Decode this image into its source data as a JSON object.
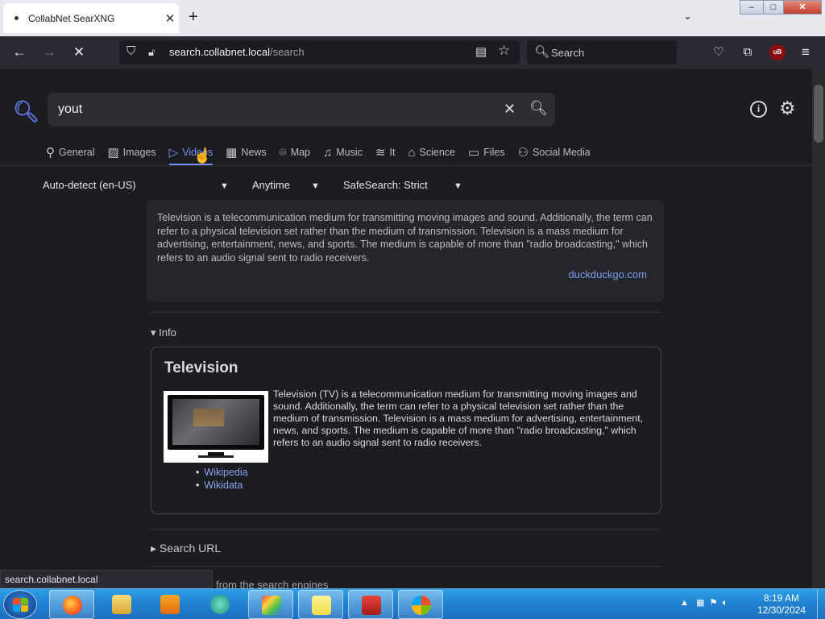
{
  "browser": {
    "tab_title": "CollabNet SearXNG",
    "tab_close": "✕",
    "new_tab": "+",
    "url_host": "search.collabnet.local",
    "url_path": "/search",
    "search_placeholder": "Search"
  },
  "search": {
    "query": "yout",
    "categories": [
      "General",
      "Images",
      "Videos",
      "News",
      "Map",
      "Music",
      "It",
      "Science",
      "Files",
      "Social Media"
    ],
    "active_category": "Videos",
    "filters": {
      "language": "Auto-detect (en-US)",
      "time": "Anytime",
      "safesearch": "SafeSearch: Strict"
    }
  },
  "answer": {
    "text": "Television is a telecommunication medium for transmitting moving images and sound. Additionally, the term can refer to a physical television set rather than the medium of transmission. Television is a mass medium for advertising, entertainment, news, and sports. The medium is capable of more than \"radio broadcasting,\" which refers to an audio signal sent to radio receivers.",
    "source": "duckduckgo.com"
  },
  "infobox": {
    "toggle": "▾ Info",
    "title": "Television",
    "description": "Television (TV) is a telecommunication medium for transmitting moving images and sound. Additionally, the term can refer to a physical television set rather than the medium of transmission. Television is a mass medium for advertising, entertainment, news, and sports. The medium is capable of more than \"radio broadcasting,\" which refers to an audio signal sent to radio receivers.",
    "links": [
      "Wikipedia",
      "Wikidata"
    ]
  },
  "search_url_toggle": "▸ Search URL",
  "cutoff_text": "from the search engines",
  "status_url": "search.collabnet.local",
  "taskbar": {
    "time": "8:19 AM",
    "date": "12/30/2024"
  },
  "colors": {
    "accent": "#7d8ff0",
    "link": "#8aa3ee",
    "background": "#1c1d21"
  }
}
